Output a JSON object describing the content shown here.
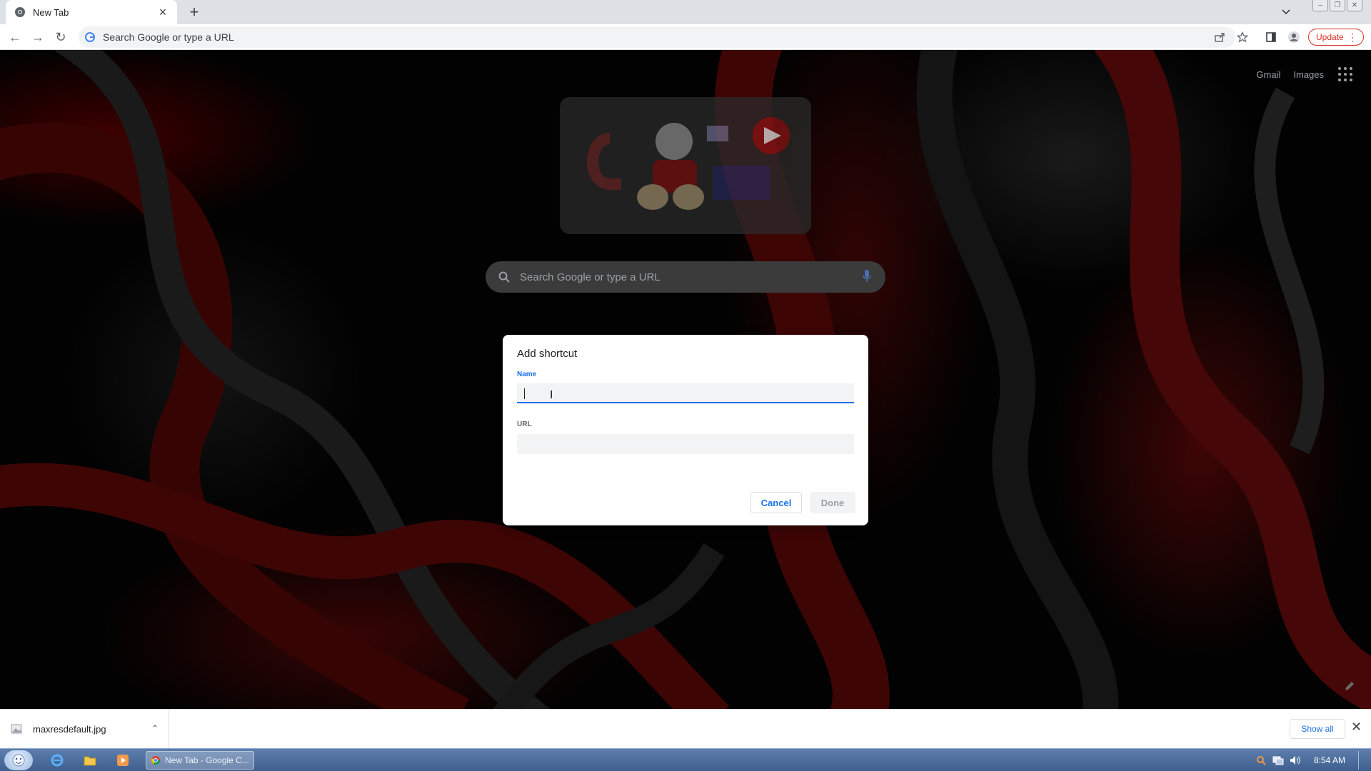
{
  "browser": {
    "tab": {
      "title": "New Tab",
      "favicon": "chrome-icon",
      "close_icon": "close-icon"
    },
    "new_tab_icon": "plus-icon",
    "omnibox": {
      "placeholder": "Search Google or type a URL"
    },
    "update_label": "Update"
  },
  "page": {
    "top_links": {
      "gmail": "Gmail",
      "images": "Images"
    },
    "searchbox_placeholder": "Search Google or type a URL"
  },
  "dialog": {
    "title": "Add shortcut",
    "name_label": "Name",
    "name_value": "",
    "url_label": "URL",
    "url_value": "",
    "cancel_label": "Cancel",
    "done_label": "Done"
  },
  "download_bar": {
    "file_name": "maxresdefault.jpg",
    "show_all_label": "Show all"
  },
  "taskbar": {
    "active_window_label": "New Tab - Google C...",
    "clock": "8:54 AM"
  },
  "colors": {
    "accent": "#1a73e8",
    "update_red": "#d93025",
    "wallpaper_red": "#8b0000"
  }
}
